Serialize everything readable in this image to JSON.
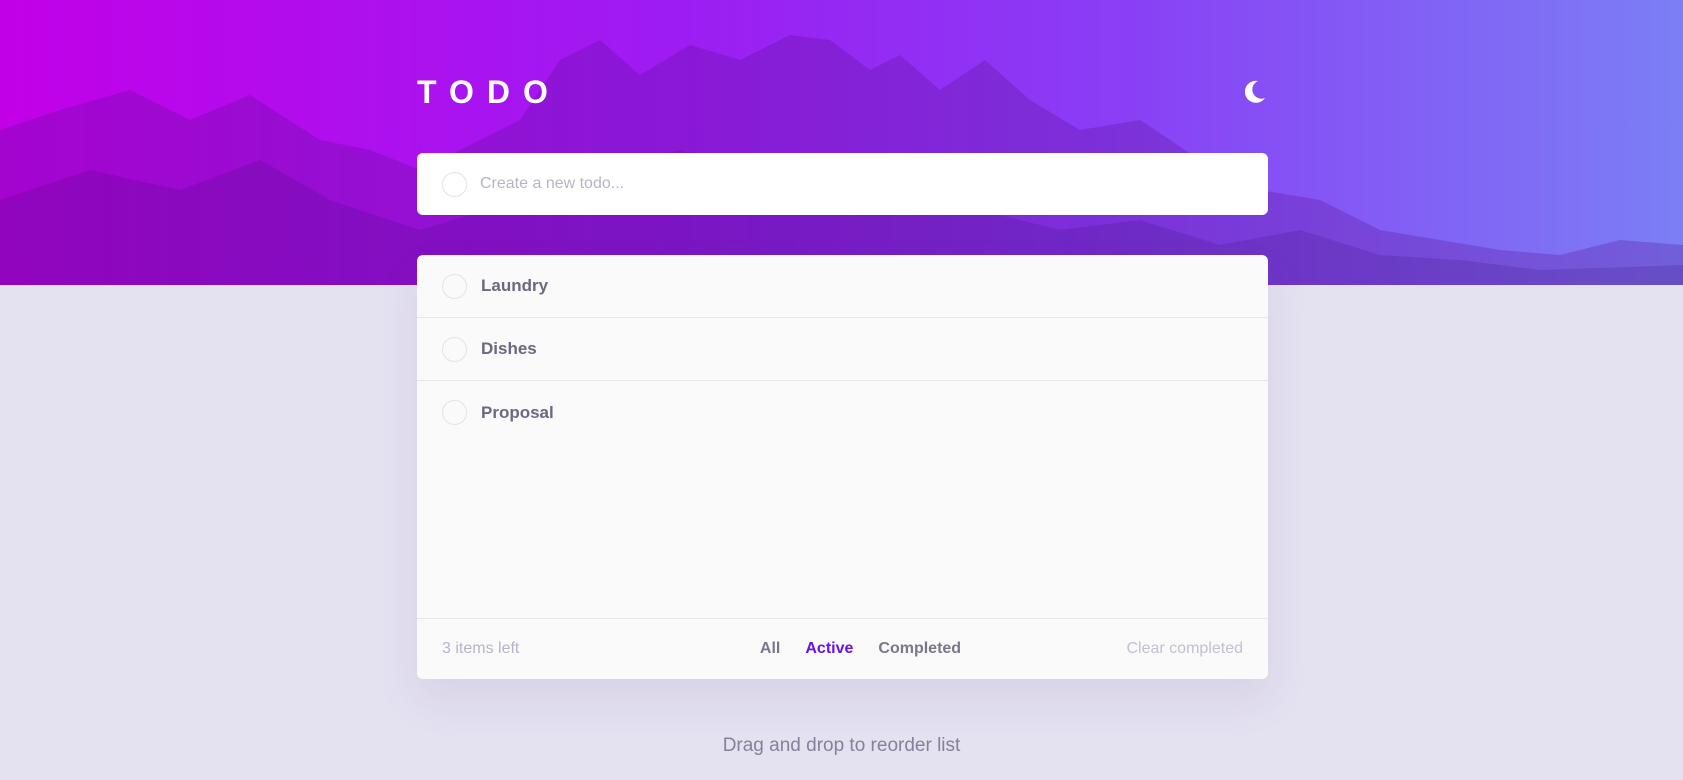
{
  "header": {
    "title": "TODO",
    "theme_icon": "moon-icon"
  },
  "new_todo": {
    "placeholder": "Create a new todo...",
    "value": ""
  },
  "todos": [
    {
      "label": "Laundry",
      "completed": false
    },
    {
      "label": "Dishes",
      "completed": false
    },
    {
      "label": "Proposal",
      "completed": false
    }
  ],
  "footer": {
    "items_left": "3 items left",
    "filters": [
      "All",
      "Active",
      "Completed"
    ],
    "active_filter": "Active",
    "clear_label": "Clear completed"
  },
  "hint": "Drag and drop to reorder list",
  "colors": {
    "gradient_start": "#c200e8",
    "gradient_end": "#7b7ff5",
    "accent": "#6a12e4",
    "page_background": "#e4e1f1"
  }
}
